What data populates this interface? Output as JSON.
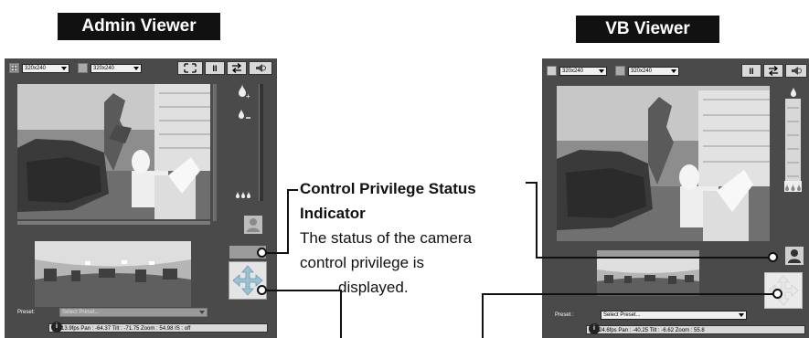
{
  "admin_viewer": {
    "title": "Admin Viewer",
    "size_select_1": "320x240",
    "size_select_2": "320x240",
    "toolbar": {
      "pause": "II"
    },
    "preset_label": "Preset:",
    "preset_placeholder": "Select Preset...",
    "status_text": "13.9fps Pan : -64.37 Tilt : -71.75 Zoom : 54.98 IS : off"
  },
  "vb_viewer": {
    "title": "VB Viewer",
    "size_select_1": "320x240",
    "size_select_2": "320x240",
    "toolbar": {
      "pause": "II"
    },
    "preset_label": "Preset :",
    "preset_placeholder": "Select Preset...",
    "status_text": "24.6fps Pan : -40.25 Tilt : -6.62 Zoom : 55.8"
  },
  "callout": {
    "title_line1": "Control Privilege Status",
    "title_line2": "Indicator",
    "desc_line1": "The status of the camera",
    "desc_line2": "control privilege is",
    "desc_line3": "displayed."
  },
  "colors": {
    "panel_bg": "#4a4a4a",
    "title_bg": "#111111",
    "privilege_bar": "#9b9b9b"
  }
}
